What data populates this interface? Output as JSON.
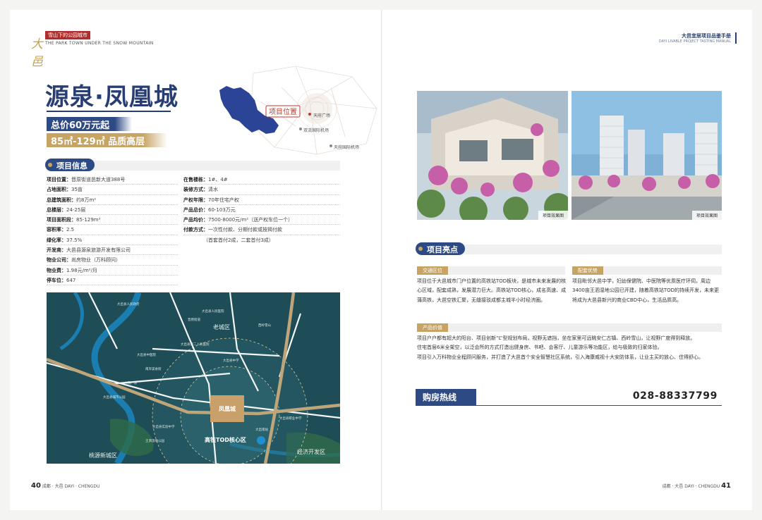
{
  "header_left": {
    "logo_char": "大邑",
    "tag": "雪山下的公园城市",
    "subtitle": "THE PARK TOWN UNDER THE SNOW MOUNTAIN"
  },
  "header_right": {
    "title": "大邑宜居项目品鉴手册",
    "subtitle": "DAYI LIVABLE PROJECT TASTING MANUAL"
  },
  "project": {
    "title": "源泉·凤凰城",
    "price_badge": "总价60万元起",
    "area_badge": "85㎡-129㎡ 品质高层"
  },
  "location_map": {
    "marker_label": "项目位置",
    "labels": [
      "天府广场",
      "双流国际机场",
      "天府国际机场"
    ]
  },
  "info_section": {
    "heading": "项目信息",
    "left_rows": [
      {
        "k": "项目位置：",
        "v": "晋原街道邑新大道388号"
      },
      {
        "k": "占地面积：",
        "v": "35亩"
      },
      {
        "k": "总建筑面积：",
        "v": "约8万m²"
      },
      {
        "k": "总楼层：",
        "v": "24-25层"
      },
      {
        "k": "项目面积段：",
        "v": "85-129m²"
      },
      {
        "k": "容积率：",
        "v": "2.5"
      },
      {
        "k": "绿化率：",
        "v": "37.5%"
      },
      {
        "k": "开发商：",
        "v": "大邑县源泉旅游开发有限公司"
      },
      {
        "k": "物业公司：",
        "v": "尚房物业（万科顾问）"
      },
      {
        "k": "物业费：",
        "v": "1.98元/m²/月"
      },
      {
        "k": "停车位：",
        "v": "647"
      }
    ],
    "right_rows": [
      {
        "k": "在售楼栋：",
        "v": "1#、4#"
      },
      {
        "k": "装修方式：",
        "v": "清水"
      },
      {
        "k": "产权年限：",
        "v": "70年住宅产权"
      },
      {
        "k": "产品总价：",
        "v": "60-103万元"
      },
      {
        "k": "产品均价：",
        "v": "7500-8000元/m²（送产权车位一个）"
      },
      {
        "k": "付款方式：",
        "v": "一次性付款、分期付款或按揭付款"
      },
      {
        "k": "",
        "v": "（首套首付2成，二套首付3成）"
      }
    ]
  },
  "big_map": {
    "district_labels": [
      "老城区",
      "桃源新城区",
      "经济开发区"
    ],
    "tod_label": "高铁TOD核心区",
    "project_label": "凤凰城",
    "place_labels": [
      "大邑县人民政府",
      "人民广场",
      "大邑县中医院",
      "大邑县第二人民医院",
      "大邑南站",
      "西岭雪山",
      "大邑县实验中学",
      "大邑县中学",
      "晋原街道",
      "大邑县城市公园",
      "南岸美食街",
      "大邑县人民医院",
      "王泗湿地公园",
      "大邑县职业中学"
    ]
  },
  "photos": [
    {
      "caption": "项目效果图"
    },
    {
      "caption": "项目效果图"
    }
  ],
  "highlights": {
    "heading": "项目亮点",
    "traffic": {
      "tag": "交通区位",
      "text": "项目位于大邑城市门户位置的高铁站TOD板块，是城市未来发展的核心区域，配套成熟，发展潜力巨大。高铁站TOD核心，成名高速、成蒲高铁，大邑空铁汇聚，无缝接驳成都主城半小时经济圈。"
    },
    "facilities": {
      "tag": "配套优势",
      "text": "项目毗邻大邑中学，妇幼保健院、中医院等优质医疗环伺，周边3400亩王泗湿地公园已开建，随着高铁站TOD的持续开发，未来更将成为大邑县新兴的商业CBD中心，生活品质高。"
    },
    "product": {
      "tag": "产品价值",
      "lines": [
        "项目户户都有超大的阳台、项目创新“L”型规划布局，视野无遮挡，坐在家里可远眺安仁古镇、西岭雪山，让视野广度得到释放。",
        "住宅首层6米全架空，以泛会所的方式打造出健身房、书吧、会客厅、儿童游乐等功能区，给与极致的归家体验。",
        "项目引入万科物业全程顾问服务，并打造了大邑首个安全智慧社区系统，引入海康威视十大安防体系，让业主买的放心、住得舒心。"
      ]
    }
  },
  "hotline": {
    "label": "购房热线",
    "number": "028-88337799"
  },
  "footer_left": {
    "page": "40",
    "text": "成都 · 大邑 DAYI · CHENGDU"
  },
  "footer_right": {
    "page": "41",
    "text": "成都 · 大邑 DAYI · CHENGDU"
  },
  "colors": {
    "navy": "#2e4a84",
    "gold": "#c7a463",
    "map_teal": "#1f4a56"
  }
}
